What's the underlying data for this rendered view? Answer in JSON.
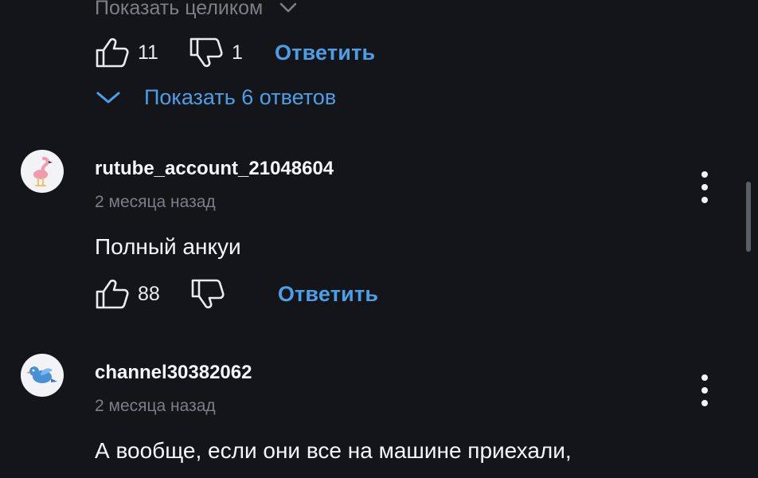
{
  "top_comment": {
    "show_full_label": "Показать целиком",
    "likes": "11",
    "dislikes": "1",
    "reply_label": "Ответить",
    "show_replies_label": "Показать 6 ответов"
  },
  "comments": [
    {
      "username": "rutube_account_21048604",
      "date": "2 месяца назад",
      "text": "Полный анкуи",
      "likes": "88",
      "dislikes": "",
      "reply_label": "Ответить",
      "avatar_icon": "flamingo-icon"
    },
    {
      "username": "channel30382062",
      "date": "2 месяца назад",
      "text": "А вообще, если они все на машине приехали,",
      "avatar_icon": "bird-icon"
    }
  ],
  "colors": {
    "background": "#141518",
    "accent": "#4a9fe8",
    "muted": "#7a7f8a",
    "text": "#f5f6f8"
  }
}
